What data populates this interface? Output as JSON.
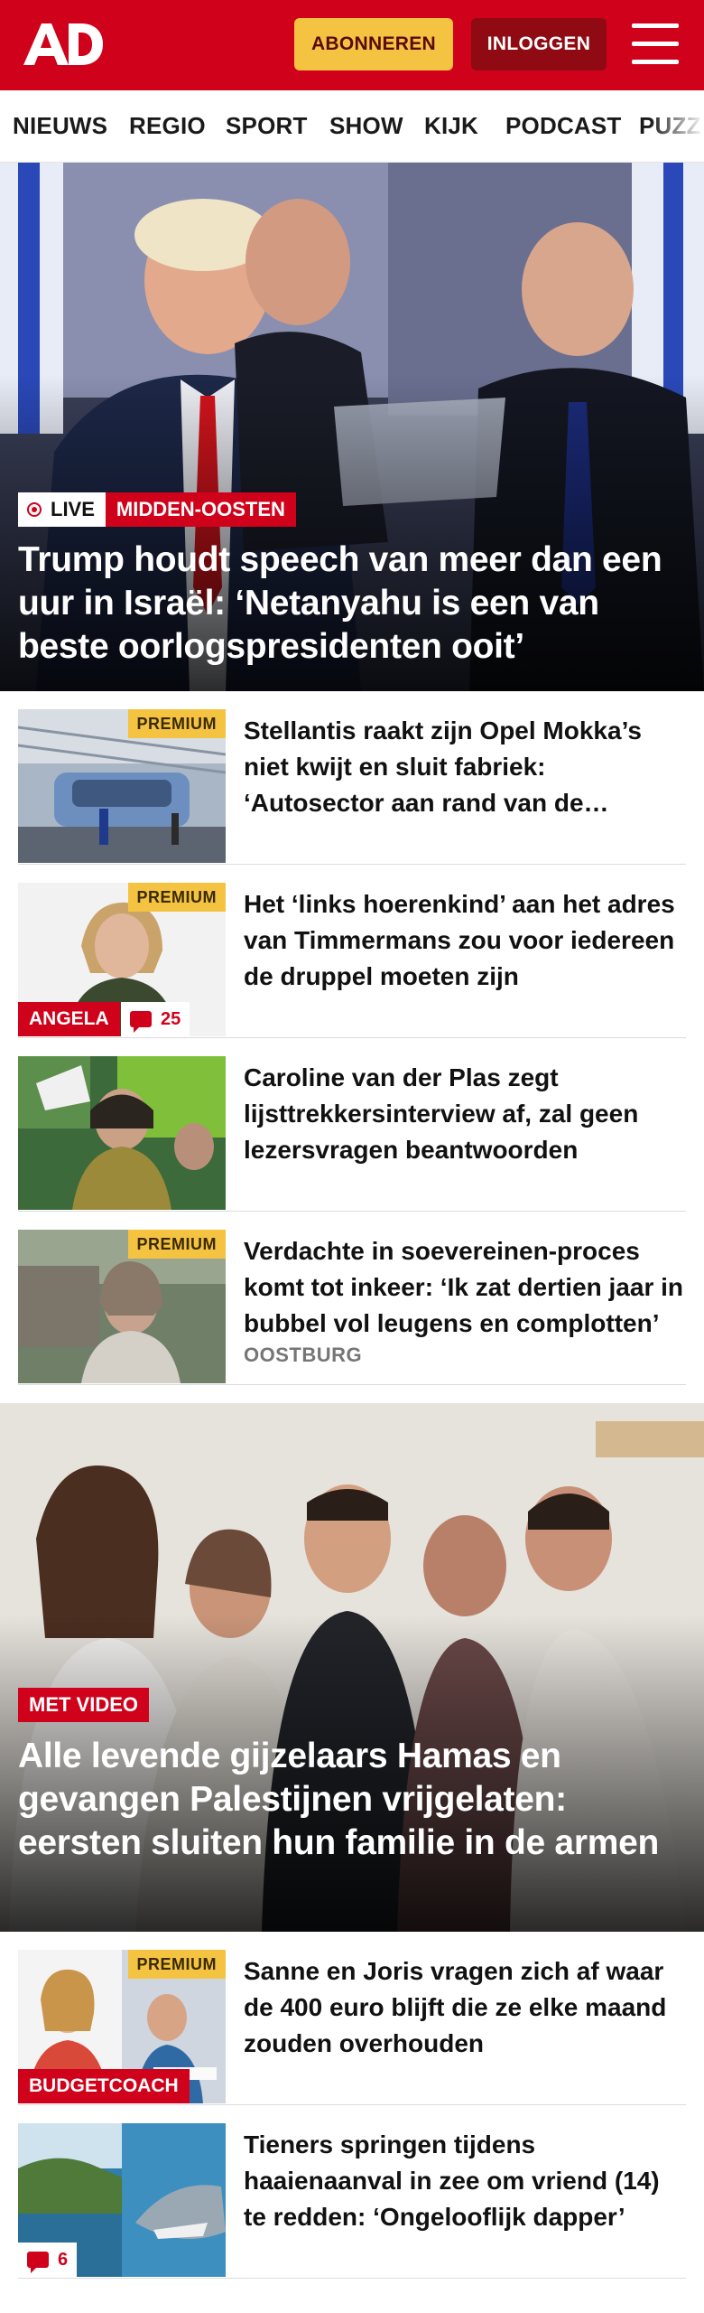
{
  "header": {
    "logo": "AD",
    "subscribe_label": "ABONNEREN",
    "login_label": "INLOGGEN"
  },
  "nav": {
    "items": [
      "NIEUWS",
      "REGIO",
      "SPORT",
      "SHOW",
      "KIJK",
      "PODCAST",
      "PUZZ"
    ]
  },
  "hero1": {
    "live_label": "LIVE",
    "category": "MIDDEN-OOSTEN",
    "title": "Trump houdt speech van meer dan een uur in Israël: ‘Netanyahu is een van beste oorlogspresidenten ooit’"
  },
  "articles1": [
    {
      "premium": "PREMIUM",
      "title": "Stellantis raakt zijn Opel Mokka’s niet kwijt en sluit fabriek: ‘Autosector aan rand van de afgrond’"
    },
    {
      "premium": "PREMIUM",
      "tag": "ANGELA",
      "comments": "25",
      "title": "Het ‘links hoerenkind’ aan het adres van Timmermans zou voor iedereen de druppel moeten zijn"
    },
    {
      "title": "Caroline van der Plas zegt lijsttrekkersinterview af, zal geen lezersvragen beantwoorden"
    },
    {
      "premium": "PREMIUM",
      "title": "Verdachte in soevereinen-proces komt tot inkeer: ‘Ik zat dertien jaar in bubbel vol leugens en complotten’",
      "location": "OOSTBURG"
    }
  ],
  "hero2": {
    "category": "MET VIDEO",
    "title": "Alle levende gijzelaars Hamas en gevangen Palestijnen vrijgelaten: eersten sluiten hun familie in de armen"
  },
  "articles2": [
    {
      "premium": "PREMIUM",
      "tag": "BUDGETCOACH",
      "title": "Sanne en Joris vragen zich af waar de 400 euro blijft die ze elke maand zouden overhouden"
    },
    {
      "comments": "6",
      "title": "Tieners springen tijdens haaienaanval in zee om vriend (14) te redden: ‘Ongelooflijk dapper’"
    }
  ],
  "colors": {
    "brand_red": "#d0021b",
    "premium_yellow": "#f5c342",
    "login_dark": "#8f0a12"
  }
}
